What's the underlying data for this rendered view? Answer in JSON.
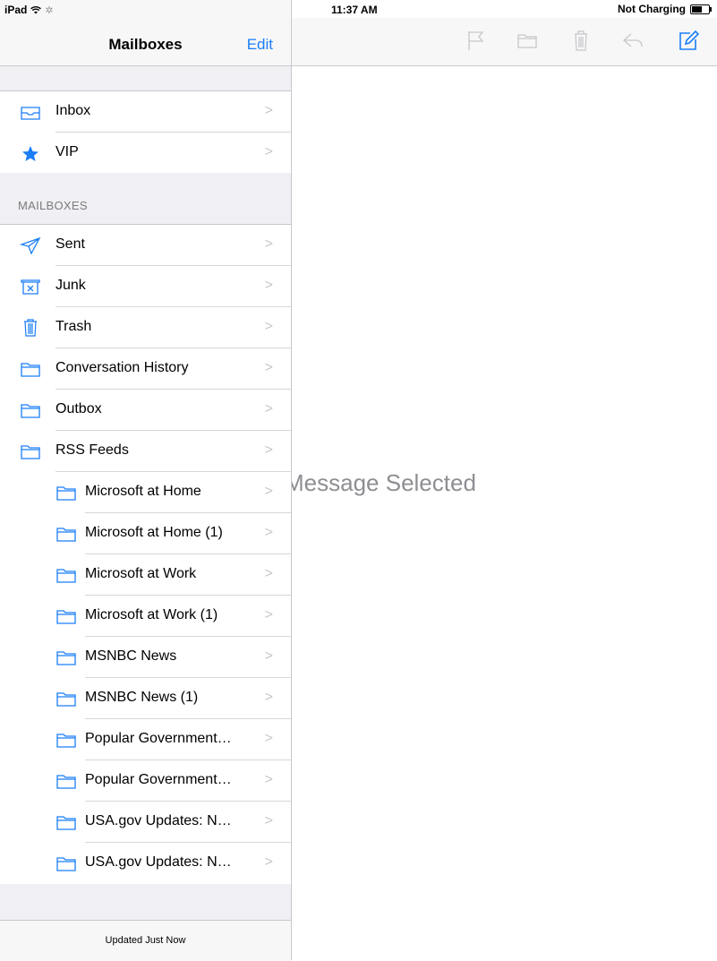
{
  "status_bar": {
    "device": "iPad",
    "time": "11:37 AM",
    "battery_text": "Not Charging"
  },
  "master": {
    "title": "Mailboxes",
    "edit_label": "Edit",
    "favorites": [
      {
        "label": "Inbox",
        "icon": "inbox-icon"
      },
      {
        "label": "VIP",
        "icon": "star-icon"
      }
    ],
    "section_label": "MAILBOXES",
    "mailboxes": [
      {
        "label": "Sent",
        "icon": "sent-icon",
        "indent": false
      },
      {
        "label": "Junk",
        "icon": "junk-icon",
        "indent": false
      },
      {
        "label": "Trash",
        "icon": "trash-icon",
        "indent": false
      },
      {
        "label": "Conversation History",
        "icon": "folder-icon",
        "indent": false
      },
      {
        "label": "Outbox",
        "icon": "folder-icon",
        "indent": false
      },
      {
        "label": "RSS Feeds",
        "icon": "folder-icon",
        "indent": false
      },
      {
        "label": "Microsoft at Home",
        "icon": "folder-icon",
        "indent": true
      },
      {
        "label": "Microsoft at Home (1)",
        "icon": "folder-icon",
        "indent": true
      },
      {
        "label": "Microsoft at Work",
        "icon": "folder-icon",
        "indent": true
      },
      {
        "label": "Microsoft at Work (1)",
        "icon": "folder-icon",
        "indent": true
      },
      {
        "label": "MSNBC News",
        "icon": "folder-icon",
        "indent": true
      },
      {
        "label": "MSNBC News (1)",
        "icon": "folder-icon",
        "indent": true
      },
      {
        "label": "Popular Government…",
        "icon": "folder-icon",
        "indent": true
      },
      {
        "label": "Popular Government…",
        "icon": "folder-icon",
        "indent": true
      },
      {
        "label": "USA.gov Updates: N…",
        "icon": "folder-icon",
        "indent": true
      },
      {
        "label": "USA.gov Updates: N…",
        "icon": "folder-icon",
        "indent": true
      }
    ],
    "footer_text": "Updated Just Now"
  },
  "detail": {
    "placeholder": "Message Selected",
    "toolbar": [
      "flag-icon",
      "folder-icon",
      "trash-icon",
      "reply-icon",
      "compose-icon"
    ]
  },
  "colors": {
    "accent": "#1a7ef7",
    "toolbar_disabled": "#c7c7cc"
  }
}
